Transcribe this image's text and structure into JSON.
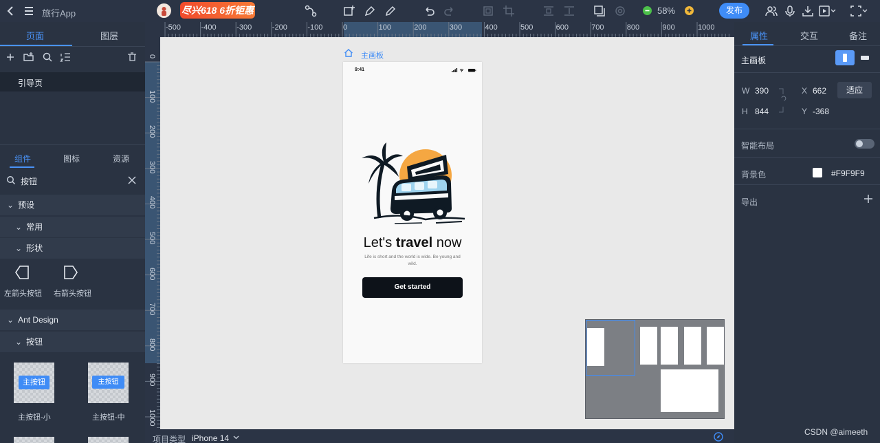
{
  "app": {
    "title": "旅行App",
    "promo": "尽兴618 6折钜惠",
    "zoom": "58%",
    "publish": "发布"
  },
  "left_panel": {
    "tabs": [
      "页面",
      "图层"
    ],
    "page_item": "引导页",
    "tabs2": [
      "组件",
      "图标",
      "资源"
    ],
    "search_value": "按钮",
    "sections": {
      "preset": "预设",
      "common": "常用",
      "shapes": "形状",
      "ant": "Ant Design",
      "buttons": "按钮"
    },
    "components": [
      "左箭头按钮",
      "右箭头按钮"
    ],
    "buttons": [
      {
        "label": "主按钮-小",
        "text": "主按钮"
      },
      {
        "label": "主按钮-中",
        "text": "主按钮"
      }
    ]
  },
  "rulers": {
    "top": [
      "-500",
      "-400",
      "-300",
      "-200",
      "-100",
      "0",
      "100",
      "200",
      "300",
      "400",
      "500",
      "600",
      "700",
      "800",
      "900",
      "1000"
    ],
    "left": [
      "0",
      "100",
      "200",
      "300",
      "400",
      "500",
      "600",
      "700",
      "800",
      "900",
      "1000"
    ]
  },
  "canvas": {
    "artboard_label": "主画板",
    "phone": {
      "time": "9:41",
      "headline_pre": "Let's ",
      "headline_bold": "travel",
      "headline_post": " now",
      "subtext": "Life is short and the world is wide. Be young and wild.",
      "cta": "Get started"
    }
  },
  "bottom": {
    "project_type_label": "项目类型",
    "device": "iPhone 14"
  },
  "right_panel": {
    "tabs": [
      "属性",
      "交互",
      "备注"
    ],
    "artboard": "主画板",
    "w_label": "W",
    "w": "390",
    "h_label": "H",
    "h": "844",
    "x_label": "X",
    "x": "662",
    "y_label": "Y",
    "y": "-368",
    "fit": "适应",
    "smart_layout": "智能布局",
    "bg_color_label": "背景色",
    "bg_color": "#F9F9F9",
    "export": "导出"
  },
  "watermark": "CSDN @aimeeth",
  "colors": {
    "accent": "#3F8CF6",
    "sun": "#F5A742",
    "van_blue": "#9ED3EE"
  }
}
